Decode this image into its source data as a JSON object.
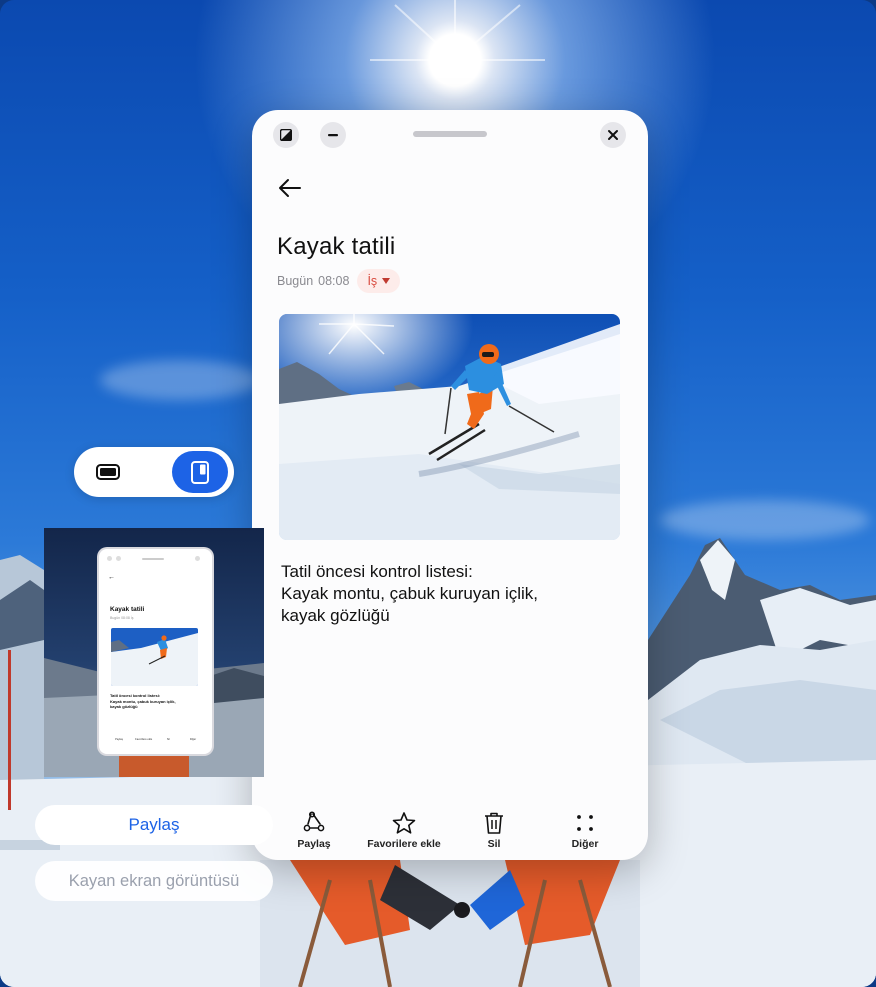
{
  "note": {
    "title": "Kayak tatili",
    "date_label": "Bugün",
    "time": "08:08",
    "category": "İş",
    "body_lines": [
      "Tatil öncesi kontrol listesi:",
      "Kayak montu, çabuk kuruyan içlik,",
      "kayak gözlüğü"
    ]
  },
  "window_controls": {
    "icons": [
      "split-view-icon",
      "minimize-icon",
      "drag-handle",
      "close-icon"
    ]
  },
  "toolbar": {
    "items": [
      {
        "label": "Paylaş",
        "icon": "share-icon"
      },
      {
        "label": "Favorilere ekle",
        "icon": "star-icon"
      },
      {
        "label": "Sil",
        "icon": "trash-icon"
      },
      {
        "label": "Diğer",
        "icon": "more-icon"
      }
    ]
  },
  "capture_panel": {
    "mode_options": [
      "landscape-mode-icon",
      "portrait-mode-icon"
    ],
    "active_mode": "portrait",
    "share_label": "Paylaş",
    "floating_screenshot_label": "Kayan ekran görüntüsü"
  },
  "thumbnail": {
    "title": "Kayak tatili",
    "meta": "Bugün 08:08  İş",
    "body_lines": [
      "Tatil öncesi kontrol listesi:",
      "Kayak montu, çabuk kuruyan içlik,",
      "kayak gözlüğü"
    ],
    "toolbar_labels": [
      "Paylaş",
      "Favorilere ekle",
      "Sil",
      "Diğer"
    ]
  },
  "colors": {
    "accent": "#1d63e6",
    "category_bg": "#fdecea",
    "category_text": "#d94b3f",
    "window_bg": "#fcfcfd"
  }
}
